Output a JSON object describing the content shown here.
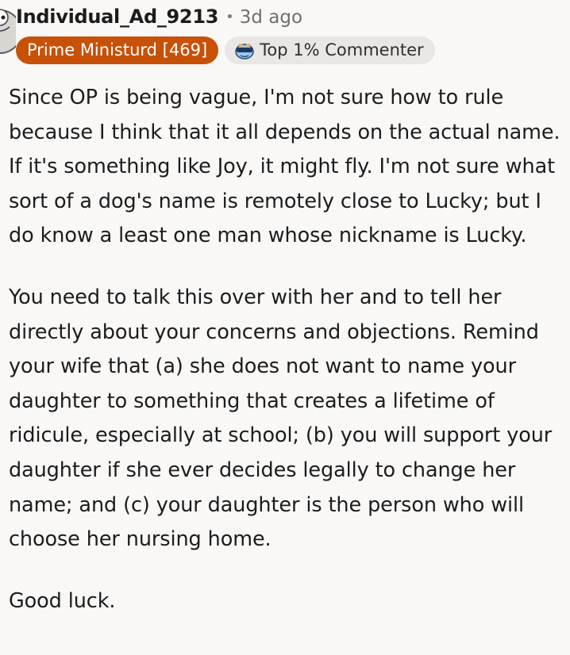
{
  "comment": {
    "author": "Individual_Ad_9213",
    "separator": "•",
    "age": "3d ago",
    "flair": "Prime Ministurd [469]",
    "badge": {
      "icon": "top-commenter-icon",
      "label": "Top 1% Commenter"
    },
    "paragraphs": [
      "Since OP is being vague, I'm not sure how to rule because I think that it all depends on the actual name. If it's something like Joy, it might fly. I'm not sure what sort of a dog's name is remotely close to Lucky; but I do know a least one man whose nickname is Lucky.",
      "You need to talk this over with her and to tell her directly about your concerns and objections. Remind your wife that (a) she does not want to name your daughter to something that creates a lifetime of ridicule, especially at school; (b) you will support your daughter if she ever decides legally to change her name; and (c) your daughter is the person who will choose her nursing home.",
      "Good luck."
    ]
  },
  "colors": {
    "flair_bg": "#c85108",
    "badge_bg": "#e9e7e5",
    "page_bg": "#f9f8f7"
  }
}
